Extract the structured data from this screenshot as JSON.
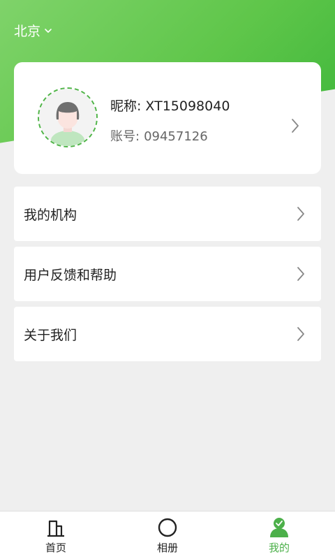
{
  "header": {
    "city": "北京",
    "city_icon": "chevron-down-icon"
  },
  "profile": {
    "nickname_label": "昵称:",
    "nickname": "XT15098040",
    "account_label": "账号:",
    "account": "09457126",
    "avatar_icon": "user-avatar-icon"
  },
  "menu": {
    "items": [
      {
        "label": "我的机构"
      },
      {
        "label": "用户反馈和帮助"
      },
      {
        "label": "关于我们"
      }
    ]
  },
  "tabbar": {
    "tabs": [
      {
        "label": "首页",
        "icon": "home-icon"
      },
      {
        "label": "相册",
        "icon": "circle-icon"
      },
      {
        "label": "我的",
        "icon": "profile-icon",
        "active": true
      }
    ]
  },
  "colors": {
    "brand_green": "#4cb04a",
    "header_gradient_start": "#7fd36a",
    "header_gradient_end": "#3db63a"
  }
}
